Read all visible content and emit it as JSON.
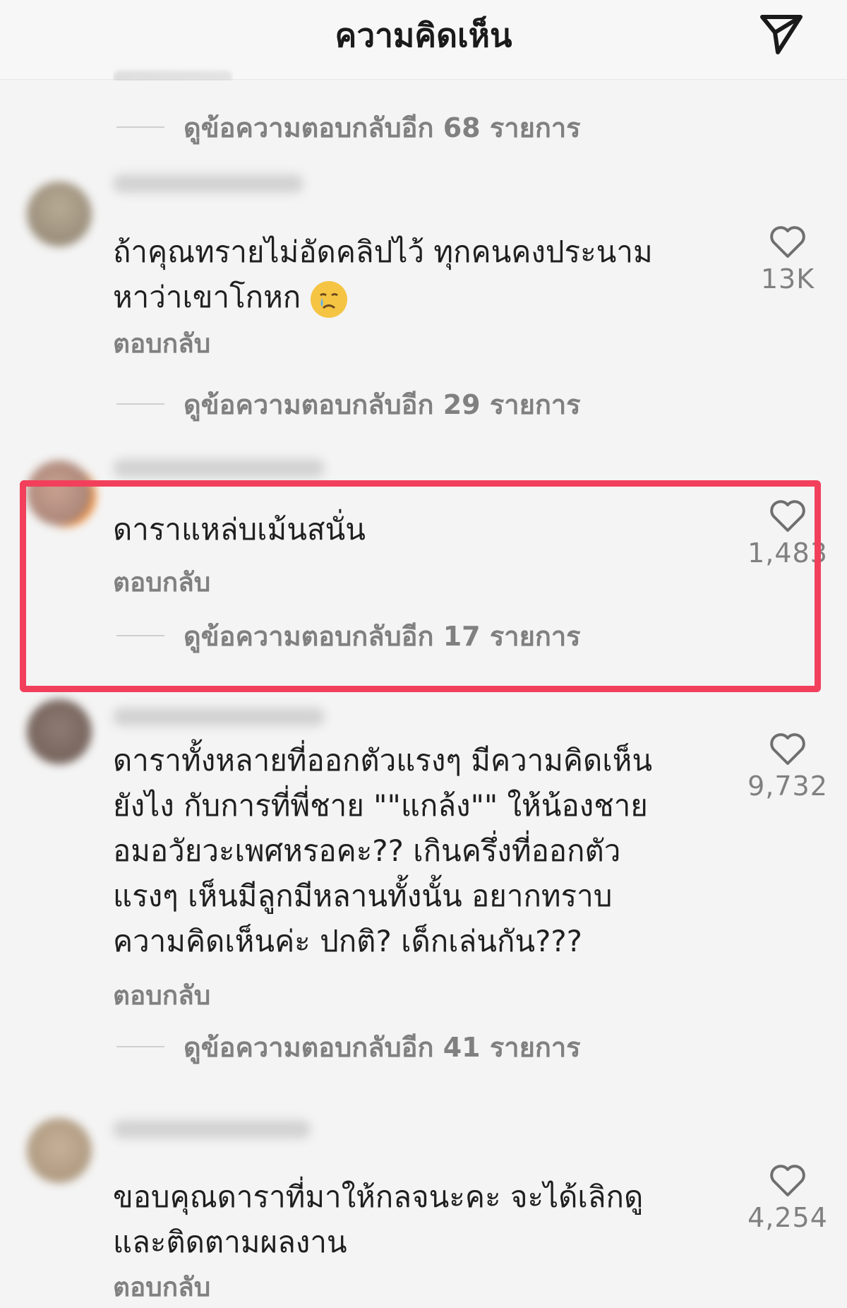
{
  "header": {
    "title": "ความคิดเห็น",
    "send_icon": "send-icon"
  },
  "colors": {
    "highlight": "#f2405c",
    "muted": "#808080",
    "text": "#1f1f1f"
  },
  "thread0": {
    "more_replies": "ดูข้อความตอบกลับอีก 68 รายการ"
  },
  "comments": [
    {
      "text_line1": "ถ้าคุณทรายไม่อัดคลิปไว้ ทุกคนคงประนาม",
      "text_line2": "หาว่าเขาโกหก",
      "emoji": "crying-face",
      "reply": "ตอบกลับ",
      "likes": "13K",
      "more_replies": "ดูข้อความตอบกลับอีก 29 รายการ"
    },
    {
      "text_line1": "ดาราแหล่บเม้นสนั่น",
      "reply": "ตอบกลับ",
      "likes": "1,483",
      "more_replies": "ดูข้อความตอบกลับอีก 17 รายการ"
    },
    {
      "lines": [
        "ดาราทั้งหลายที่ออกตัวแรงๆ มีความคิดเห็น",
        "ยังไง กับการที่พี่ชาย \"\"แกล้ง\"\" ให้น้องชาย",
        "อมอวัยวะเพศหรอคะ?? เกินครึ่งที่ออกตัว",
        "แรงๆ เห็นมีลูกมีหลานทั้งนั้น อยากทราบ",
        "ความคิดเห็นค่ะ ปกติ? เด็กเล่นกัน???"
      ],
      "reply": "ตอบกลับ",
      "likes": "9,732",
      "more_replies": "ดูข้อความตอบกลับอีก 41 รายการ"
    },
    {
      "lines": [
        "ขอบคุณดาราที่มาให้กลจนะคะ จะได้เลิกดู",
        "และติดตามผลงาน"
      ],
      "reply": "ตอบกลับ",
      "likes": "4,254"
    }
  ]
}
